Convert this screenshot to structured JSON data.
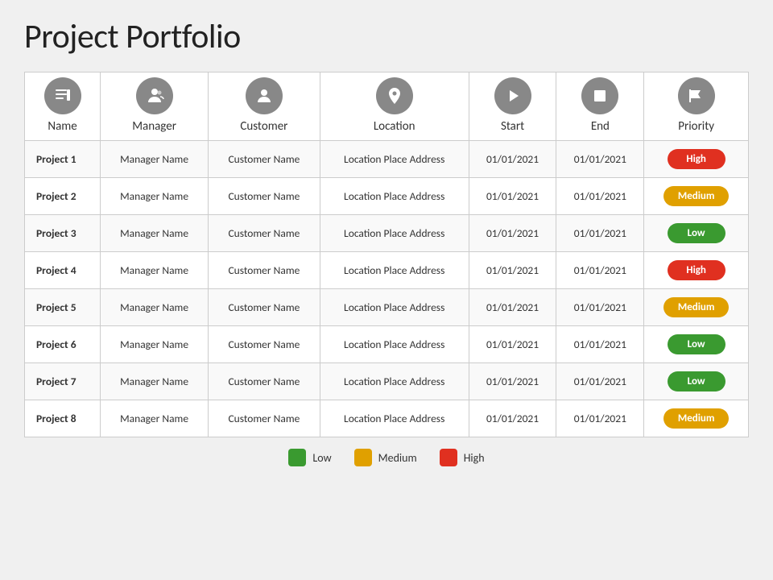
{
  "title": "Project Portfolio",
  "columns": [
    {
      "key": "name",
      "label": "Name",
      "icon": "name"
    },
    {
      "key": "manager",
      "label": "Manager",
      "icon": "manager"
    },
    {
      "key": "customer",
      "label": "Customer",
      "icon": "customer"
    },
    {
      "key": "location",
      "label": "Location",
      "icon": "location"
    },
    {
      "key": "start",
      "label": "Start",
      "icon": "start"
    },
    {
      "key": "end",
      "label": "End",
      "icon": "end"
    },
    {
      "key": "priority",
      "label": "Priority",
      "icon": "priority"
    }
  ],
  "rows": [
    {
      "name": "Project 1",
      "manager": "Manager Name",
      "customer": "Customer  Name",
      "location": "Location Place Address",
      "start": "01/01/2021",
      "end": "01/01/2021",
      "priority": "High"
    },
    {
      "name": "Project 2",
      "manager": "Manager Name",
      "customer": "Customer  Name",
      "location": "Location Place Address",
      "start": "01/01/2021",
      "end": "01/01/2021",
      "priority": "Medium"
    },
    {
      "name": "Project 3",
      "manager": "Manager Name",
      "customer": "Customer  Name",
      "location": "Location Place Address",
      "start": "01/01/2021",
      "end": "01/01/2021",
      "priority": "Low"
    },
    {
      "name": "Project 4",
      "manager": "Manager Name",
      "customer": "Customer  Name",
      "location": "Location Place Address",
      "start": "01/01/2021",
      "end": "01/01/2021",
      "priority": "High"
    },
    {
      "name": "Project 5",
      "manager": "Manager Name",
      "customer": "Customer  Name",
      "location": "Location Place Address",
      "start": "01/01/2021",
      "end": "01/01/2021",
      "priority": "Medium"
    },
    {
      "name": "Project 6",
      "manager": "Manager Name",
      "customer": "Customer  Name",
      "location": "Location Place Address",
      "start": "01/01/2021",
      "end": "01/01/2021",
      "priority": "Low"
    },
    {
      "name": "Project 7",
      "manager": "Manager Name",
      "customer": "Customer  Name",
      "location": "Location Place Address",
      "start": "01/01/2021",
      "end": "01/01/2021",
      "priority": "Low"
    },
    {
      "name": "Project 8",
      "manager": "Manager Name",
      "customer": "Customer  Name",
      "location": "Location Place Address",
      "start": "01/01/2021",
      "end": "01/01/2021",
      "priority": "Medium"
    }
  ],
  "legend": [
    {
      "label": "Low",
      "color": "low"
    },
    {
      "label": "Medium",
      "color": "medium"
    },
    {
      "label": "High",
      "color": "high"
    }
  ]
}
